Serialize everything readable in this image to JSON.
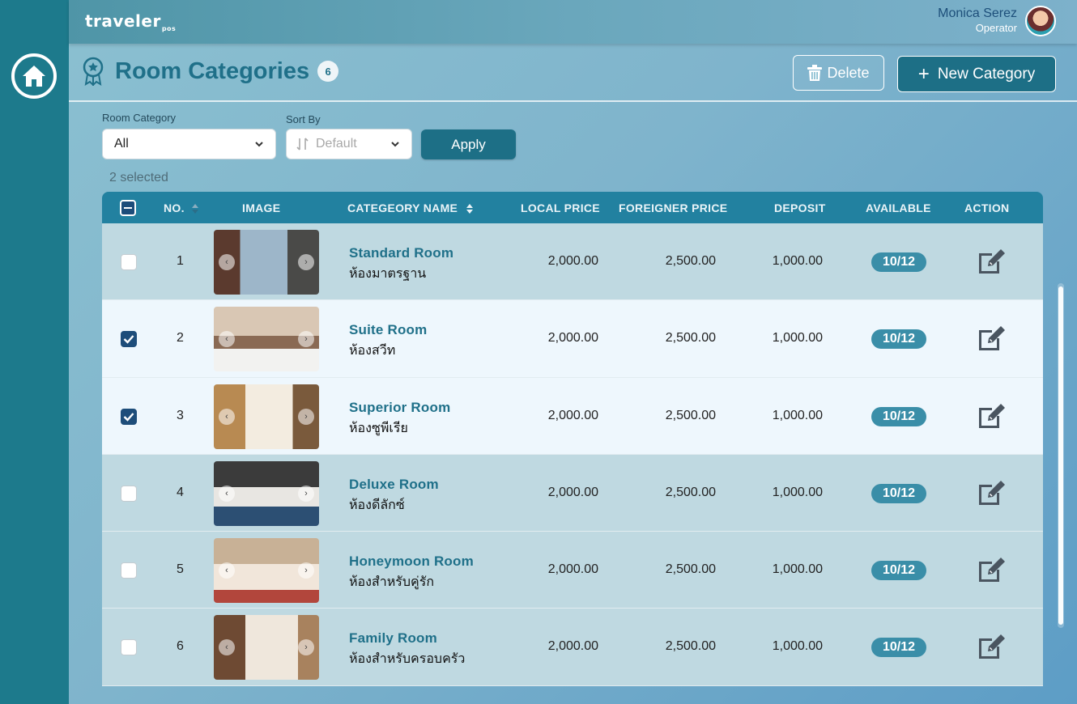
{
  "app": {
    "logo_text": "traveler",
    "logo_sub": "pos"
  },
  "user": {
    "name": "Monica Serez",
    "role": "Operator"
  },
  "page": {
    "title": "Room Categories",
    "count": "6"
  },
  "actions": {
    "delete_label": "Delete",
    "new_label": "New Category"
  },
  "filters": {
    "category_label": "Room Category",
    "category_value": "All",
    "sort_label": "Sort By",
    "sort_value": "Default",
    "apply_label": "Apply"
  },
  "selection": {
    "text": "2 selected"
  },
  "table": {
    "headers": {
      "no": "NO.",
      "image": "IMAGE",
      "name": "CATEGEORY NAME",
      "local": "LOCAL PRICE",
      "foreign": "FOREIGNER PRICE",
      "deposit": "DEPOSIT",
      "available": "AVAILABLE",
      "action": "ACTION"
    },
    "rows": [
      {
        "no": "1",
        "name_en": "Standard Room",
        "name_th": "ห้องมาตรฐาน",
        "local": "2,000.00",
        "foreign": "2,500.00",
        "deposit": "1,000.00",
        "available": "10/12",
        "checked": false
      },
      {
        "no": "2",
        "name_en": "Suite Room",
        "name_th": "ห้องสวีท",
        "local": "2,000.00",
        "foreign": "2,500.00",
        "deposit": "1,000.00",
        "available": "10/12",
        "checked": true
      },
      {
        "no": "3",
        "name_en": "Superior Room",
        "name_th": "ห้องซูพีเรีย",
        "local": "2,000.00",
        "foreign": "2,500.00",
        "deposit": "1,000.00",
        "available": "10/12",
        "checked": true
      },
      {
        "no": "4",
        "name_en": "Deluxe Room",
        "name_th": "ห้องดีลักซ์",
        "local": "2,000.00",
        "foreign": "2,500.00",
        "deposit": "1,000.00",
        "available": "10/12",
        "checked": false
      },
      {
        "no": "5",
        "name_en": "Honeymoon Room",
        "name_th": "ห้องสำหรับคู่รัก",
        "local": "2,000.00",
        "foreign": "2,500.00",
        "deposit": "1,000.00",
        "available": "10/12",
        "checked": false
      },
      {
        "no": "6",
        "name_en": "Family Room",
        "name_th": "ห้องสำหรับครอบครัว",
        "local": "2,000.00",
        "foreign": "2,500.00",
        "deposit": "1,000.00",
        "available": "10/12",
        "checked": false
      }
    ]
  },
  "colors": {
    "primary": "#1d6f86",
    "sidebar": "#1d7a8c",
    "title": "#1f7089",
    "checkbox": "#1d4d7a",
    "badge": "#3a8ea8"
  }
}
